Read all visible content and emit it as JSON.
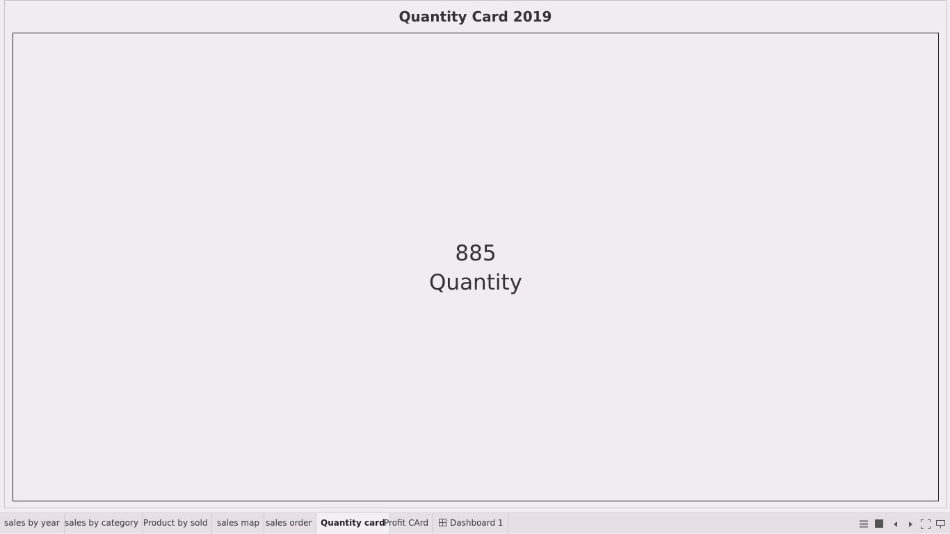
{
  "worksheet": {
    "title": "Quantity Card 2019",
    "kpi": {
      "value": "885",
      "label": "Quantity"
    }
  },
  "tabs": [
    {
      "label": "sales by year"
    },
    {
      "label": "sales by category"
    },
    {
      "label": "Product  by sold"
    },
    {
      "label": "sales map"
    },
    {
      "label": "sales  order"
    },
    {
      "label": "Quantity card"
    },
    {
      "label": "Profit CArd"
    },
    {
      "label": "Dashboard 1"
    }
  ],
  "active_tab": "Quantity card",
  "controls": {
    "icons": [
      "show-sheets-icon",
      "filmstrip-icon",
      "previous-sheet-icon",
      "next-sheet-icon",
      "fit-screen-icon",
      "presentation-mode-icon"
    ]
  },
  "colors": {
    "background": "#f1ebf2",
    "tabbar": "#e6dfe6",
    "text": "#333333"
  }
}
